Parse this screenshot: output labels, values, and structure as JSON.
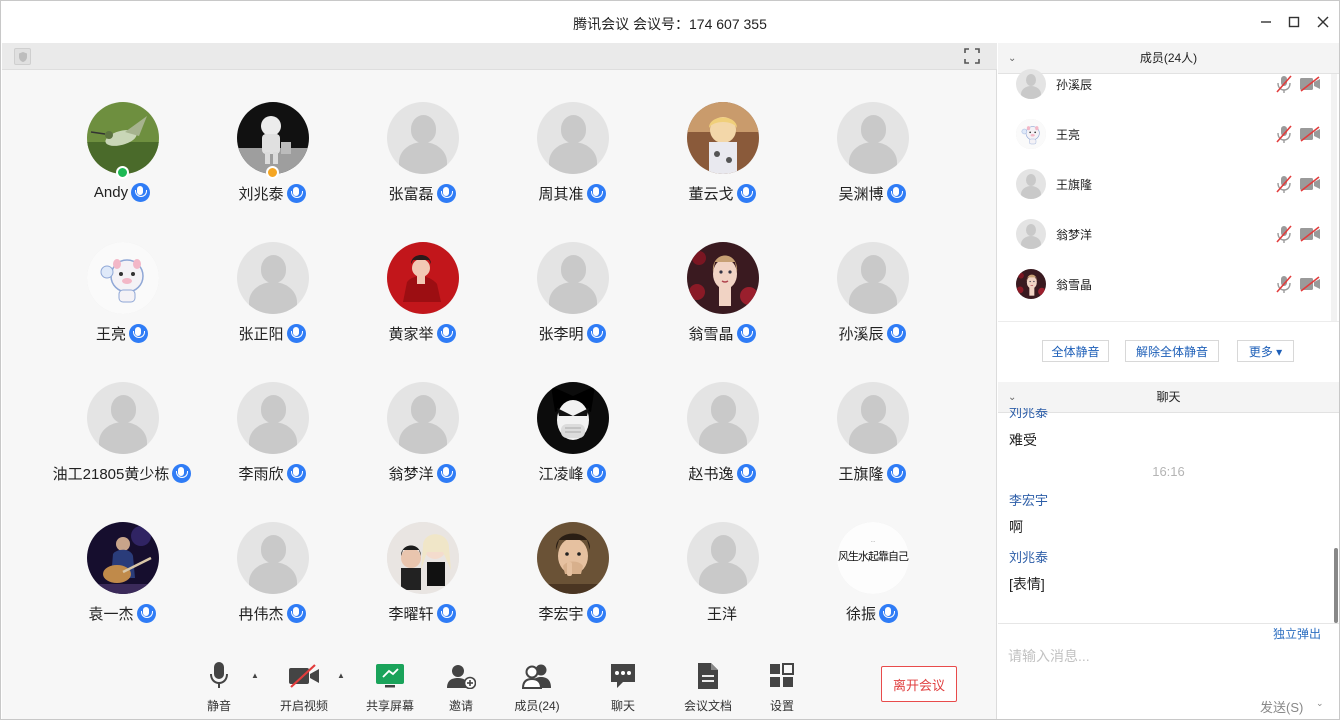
{
  "window": {
    "title": "腾讯会议 会议号：174 607 355"
  },
  "participants": [
    {
      "name": "Andy",
      "avatar": "photo-hummingbird",
      "badge": "#1db954"
    },
    {
      "name": "刘兆泰",
      "avatar": "photo-astronaut",
      "badge": "#f5a623"
    },
    {
      "name": "张富磊",
      "avatar": "default"
    },
    {
      "name": "周其准",
      "avatar": "default"
    },
    {
      "name": "董云戈",
      "avatar": "photo-child"
    },
    {
      "name": "吴渊博",
      "avatar": "default"
    },
    {
      "name": "王亮",
      "avatar": "photo-cartoon-pig"
    },
    {
      "name": "张正阳",
      "avatar": "default"
    },
    {
      "name": "黄家举",
      "avatar": "photo-red-woman"
    },
    {
      "name": "张李明",
      "avatar": "default"
    },
    {
      "name": "翁雪晶",
      "avatar": "photo-woman-roses"
    },
    {
      "name": "孙溪辰",
      "avatar": "default"
    },
    {
      "name": "油工21805黄少栋",
      "avatar": "default"
    },
    {
      "name": "李雨欣",
      "avatar": "default"
    },
    {
      "name": "翁梦洋",
      "avatar": "default"
    },
    {
      "name": "江凌峰",
      "avatar": "photo-anime-mask"
    },
    {
      "name": "赵书逸",
      "avatar": "default"
    },
    {
      "name": "王旗隆",
      "avatar": "default"
    },
    {
      "name": "袁一杰",
      "avatar": "photo-guitarist"
    },
    {
      "name": "冉伟杰",
      "avatar": "default"
    },
    {
      "name": "李曜轩",
      "avatar": "photo-couple"
    },
    {
      "name": "李宏宇",
      "avatar": "photo-young-man"
    },
    {
      "name": "王洋",
      "avatar": "default",
      "no_mic": true
    },
    {
      "name": "徐振",
      "avatar": "photo-calligraphy",
      "calligraphy_text": "风生水起靠自己"
    }
  ],
  "toolbar": {
    "mute_label": "静音",
    "video_label": "开启视频",
    "share_label": "共享屏幕",
    "invite_label": "邀请",
    "members_label": "成员(24)",
    "chat_label": "聊天",
    "docs_label": "会议文档",
    "settings_label": "设置",
    "leave_label": "离开会议"
  },
  "members_panel": {
    "title": "成员(24人)",
    "list": [
      {
        "name": "孙溪辰",
        "avatar": "default"
      },
      {
        "name": "王亮",
        "avatar": "photo-cartoon-pig"
      },
      {
        "name": "王旗隆",
        "avatar": "default"
      },
      {
        "name": "翁梦洋",
        "avatar": "default"
      },
      {
        "name": "翁雪晶",
        "avatar": "photo-woman-roses"
      }
    ],
    "mute_all_label": "全体静音",
    "unmute_all_label": "解除全体静音",
    "more_label": "更多 ▾"
  },
  "chat_panel": {
    "title": "聊天",
    "messages": [
      {
        "sender": "刘兆泰",
        "text": "难受"
      },
      {
        "time": "16:16"
      },
      {
        "sender": "李宏宇",
        "text": "啊"
      },
      {
        "sender": "刘兆泰",
        "text": "[表情]"
      }
    ],
    "popout_label": "独立弹出",
    "input_placeholder": "请输入消息...",
    "send_label": "发送(S)"
  },
  "colors": {
    "accent_blue": "#2f7cf6",
    "sender_blue": "#2d5ea8",
    "leave_red": "#e04040",
    "share_green": "#1aa35a"
  }
}
